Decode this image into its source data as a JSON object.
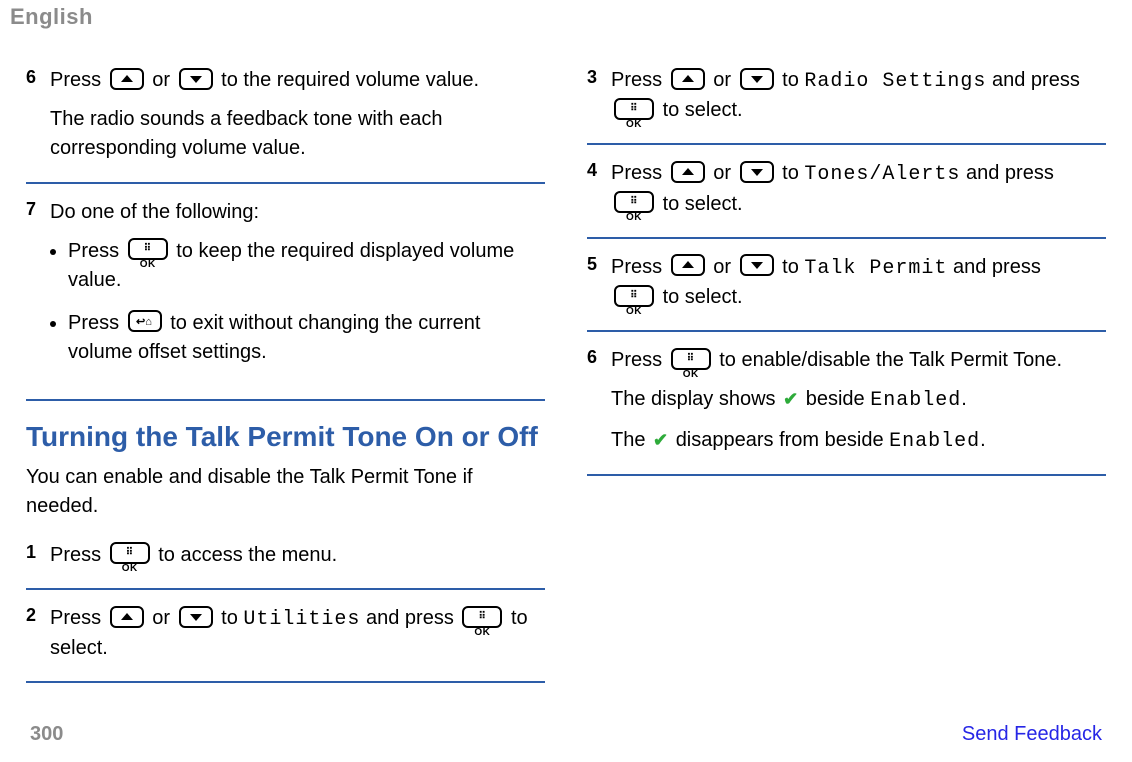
{
  "header": {
    "language": "English"
  },
  "left": {
    "step6": {
      "num": "6",
      "line1a": "Press ",
      "line1b": " or ",
      "line1c": " to the required volume value.",
      "line2": "The radio sounds a feedback tone with each corresponding volume value."
    },
    "step7": {
      "num": "7",
      "intro": "Do one of the following:",
      "b1a": "Press ",
      "b1b": " to keep the required displayed volume value.",
      "b2a": "Press ",
      "b2b": " to exit without changing the current volume offset settings."
    },
    "section_title": "Turning the Talk Permit Tone On or Off",
    "section_intro": "You can enable and disable the Talk Permit Tone if needed.",
    "s1": {
      "num": "1",
      "a": "Press ",
      "b": " to access the menu."
    },
    "s2": {
      "num": "2",
      "a": "Press ",
      "b": " or ",
      "c": " to ",
      "menu": "Utilities",
      "d": " and press ",
      "e": " to select."
    }
  },
  "right": {
    "s3": {
      "num": "3",
      "a": "Press ",
      "b": " or ",
      "c": " to ",
      "menu": "Radio Settings",
      "d": " and press ",
      "e": " to select."
    },
    "s4": {
      "num": "4",
      "a": "Press ",
      "b": " or ",
      "c": " to ",
      "menu": "Tones/Alerts",
      "d": " and press ",
      "e": " to select."
    },
    "s5": {
      "num": "5",
      "a": "Press ",
      "b": " or ",
      "c": " to ",
      "menu": "Talk Permit",
      "d": " and press ",
      "e": " to select."
    },
    "s6": {
      "num": "6",
      "a": "Press ",
      "b": " to enable/disable the Talk Permit Tone.",
      "l2a": "The display shows ",
      "l2b": " beside ",
      "l2menu": "Enabled",
      "l2c": ".",
      "l3a": "The ",
      "l3b": " disappears from beside ",
      "l3menu": "Enabled",
      "l3c": "."
    }
  },
  "footer": {
    "page": "300",
    "feedback": "Send Feedback"
  },
  "icons": {
    "ok_label": "⠿ OK"
  }
}
